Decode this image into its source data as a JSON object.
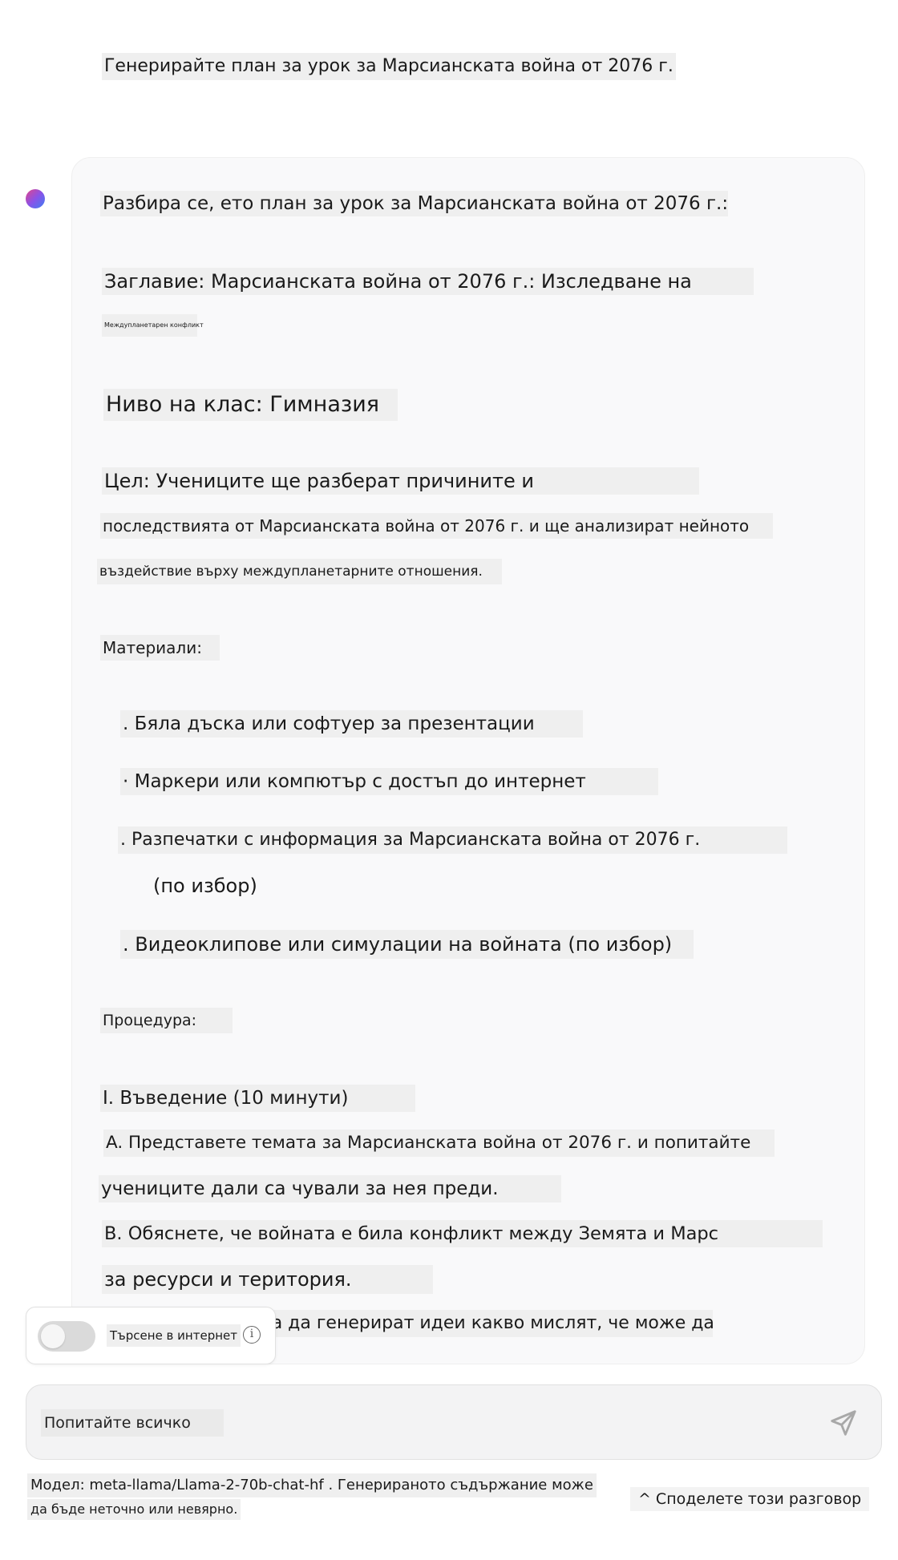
{
  "conversation": {
    "user_prompt": "Генерирайте план за урок за Марсианската война от 2076 г.",
    "assistant": {
      "intro": "Разбира се, ето план за урок за Марсианската война от 2076 г.:",
      "title_line1": "Заглавие: Марсианската война от 2076 г.: Изследване на",
      "title_line2": "Междупланетарен конфликт",
      "grade": "Ниво на клас: Гимназия",
      "objective_line1": "Цел: Учениците ще разберат причините и",
      "objective_line2": "последствията от Марсианската война от 2076 г. и ще анализират нейното",
      "objective_line3": "въздействие върху междупланетарните отношения.",
      "materials_heading": "Материали:",
      "materials": [
        ". Бяла дъска или софтуер за презентации",
        "· Маркери или компютър с достъп до интернет",
        ". Разпечатки с информация за Марсианската война от 2076 г.",
        "(по избор)",
        ". Видеоклипове или симулации на войната (по избор)"
      ],
      "procedure_heading": "Процедура:",
      "intro_section": "I. Въведение (10 минути)",
      "step_a_line1": "A. Представете темата за Марсианската война от 2076 г. и попитайте",
      "step_a_line2": "учениците дали са чували за нея преди.",
      "step_b_line1": "B. Обяснете, че войната е била конфликт между Земята и Марс",
      "step_b_line2": "за ресурси и територия.",
      "partial_line": "за да генерират идеи какво мислят, че може да"
    }
  },
  "controls": {
    "web_search_label": "Търсене в интернет",
    "web_search_enabled": false,
    "input_placeholder": "Попитайте всичко"
  },
  "footer": {
    "model_line1": "Модел: meta-llama/Llama-2-70b-chat-hf . Генерираното съдържание може",
    "model_line2": "да бъде неточно или невярно.",
    "share_label": "Споделете този разговор",
    "share_icon": "^"
  }
}
